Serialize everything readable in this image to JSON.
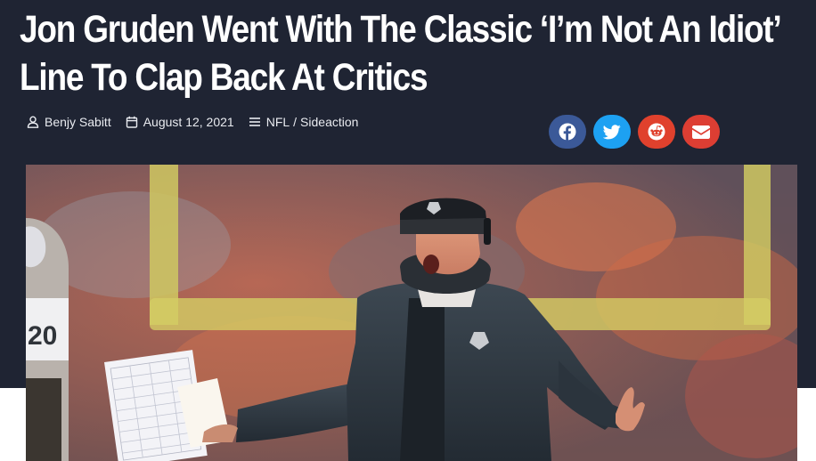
{
  "article": {
    "title_line1": "Jon Gruden Went With The Classic ‘I’m Not An Idiot’",
    "title_line2": "Line To Clap Back At Critics",
    "author": "Benjy Sabitt",
    "date": "August 12, 2021",
    "categories": [
      "NFL",
      "Sideaction"
    ],
    "category_separator": "/"
  },
  "share": {
    "buttons": [
      {
        "network": "facebook",
        "icon": "facebook-icon",
        "color": "#3b5998"
      },
      {
        "network": "twitter",
        "icon": "twitter-icon",
        "color": "#1da1f2"
      },
      {
        "network": "reddit",
        "icon": "reddit-icon",
        "color": "#e0412d"
      },
      {
        "network": "email",
        "icon": "envelope-icon",
        "color": "#dd3e33"
      }
    ]
  },
  "hero_image": {
    "jersey_number": "20"
  },
  "colors": {
    "header_bg": "#1f2433",
    "page_bg": "#ffffff",
    "meta_text": "#e9ebf0"
  }
}
